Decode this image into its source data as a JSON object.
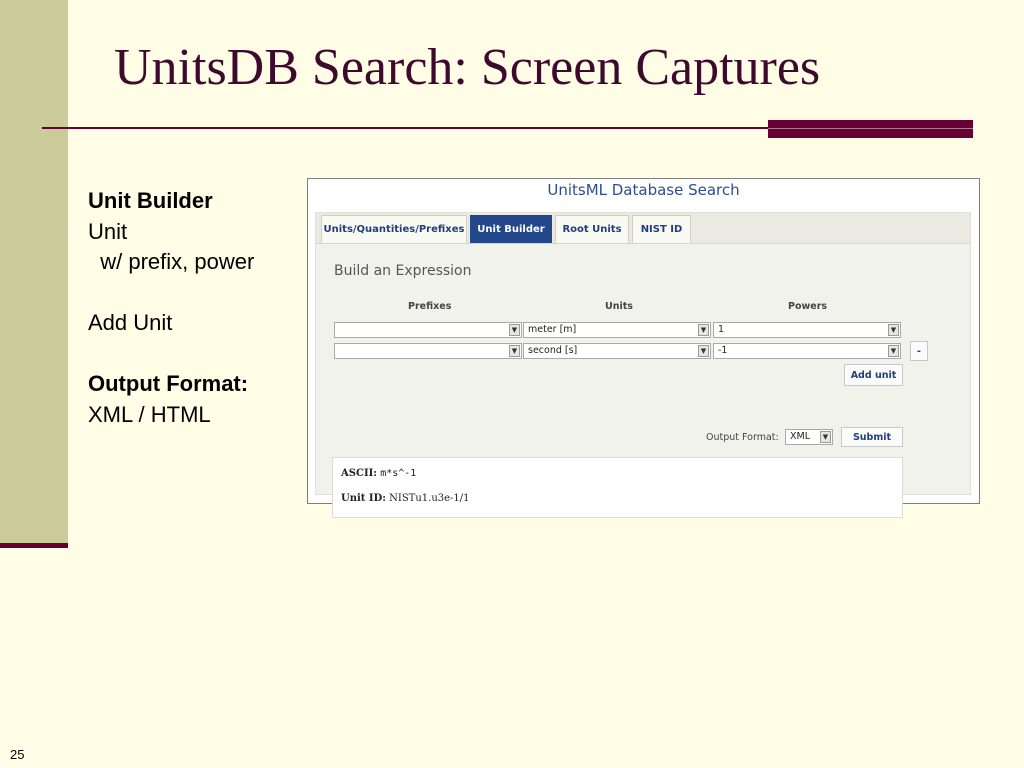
{
  "slide": {
    "title": "UnitsDB Search: Screen Captures",
    "page_number": "25",
    "bullets": {
      "unit_builder": "Unit Builder",
      "unit": "Unit",
      "prefix_power": "  w/ prefix, power",
      "add_unit": "Add Unit",
      "output_format": "Output Format:",
      "xml_html": "XML / HTML"
    },
    "colors": {
      "background": "#FFFDE5",
      "sidebar": "#CCCC9A",
      "accent": "#660033",
      "title": "#3D0A2E"
    }
  },
  "screenshot": {
    "title": "UnitsML Database Search",
    "tabs": [
      {
        "label": "Units/Quantities/Prefixes",
        "active": false
      },
      {
        "label": "Unit Builder",
        "active": true
      },
      {
        "label": "Root Units",
        "active": false
      },
      {
        "label": "NIST ID",
        "active": false
      }
    ],
    "section_title": "Build an Expression",
    "columns": {
      "prefixes": "Prefixes",
      "units": "Units",
      "powers": "Powers"
    },
    "rows": [
      {
        "prefix": "",
        "unit": "meter [m]",
        "power": "1"
      },
      {
        "prefix": "",
        "unit": "second [s]",
        "power": "-1",
        "remove_label": "-"
      }
    ],
    "add_unit_label": "Add unit",
    "output_format_label": "Output Format:",
    "output_format_value": "XML",
    "submit_label": "Submit",
    "result": {
      "ascii_label": "ASCII:",
      "ascii_value": "m*s^-1",
      "unit_id_label": "Unit ID:",
      "unit_id_value": "NISTu1.u3e-1/1"
    },
    "icons": {
      "dropdown": "chevron-down-icon"
    },
    "colors": {
      "active_tab": "#23478A",
      "link_text": "#1F3F7A"
    }
  }
}
